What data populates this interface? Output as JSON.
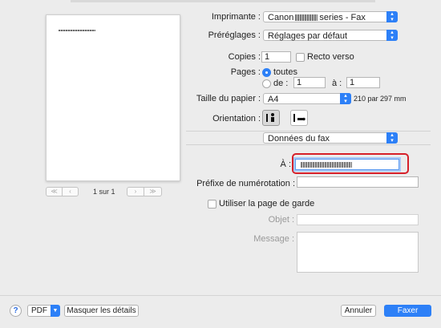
{
  "preview": {
    "page_counter": "1 sur 1",
    "nav_first": "≪",
    "nav_prev": "‹",
    "nav_next": "›",
    "nav_last": "≫"
  },
  "printer": {
    "label": "Imprimante :",
    "value_prefix": "Canon",
    "value_suffix": "series - Fax"
  },
  "presets": {
    "label": "Préréglages :",
    "value": "Réglages par défaut"
  },
  "copies": {
    "label": "Copies :",
    "value": "1",
    "duplex_label": "Recto verso"
  },
  "pages": {
    "label": "Pages :",
    "all_label": "toutes",
    "from_label": "de :",
    "from_value": "1",
    "to_label": "à :",
    "to_value": "1"
  },
  "paper": {
    "label": "Taille du papier :",
    "value": "A4",
    "dims": "210 par 297 mm"
  },
  "orientation": {
    "label": "Orientation :"
  },
  "section": {
    "value": "Données du fax"
  },
  "fax": {
    "to_label": "À :",
    "prefix_label": "Préfixe de numérotation :",
    "prefix_value": "",
    "cover_label": "Utiliser la page de garde",
    "subject_label": "Objet :",
    "message_label": "Message :"
  },
  "footer": {
    "help": "?",
    "pdf_label": "PDF",
    "hide_details_label": "Masquer les détails",
    "cancel_label": "Annuler",
    "send_label": "Faxer"
  },
  "colors": {
    "accent": "#2d80f7",
    "highlight": "#d6202a"
  }
}
